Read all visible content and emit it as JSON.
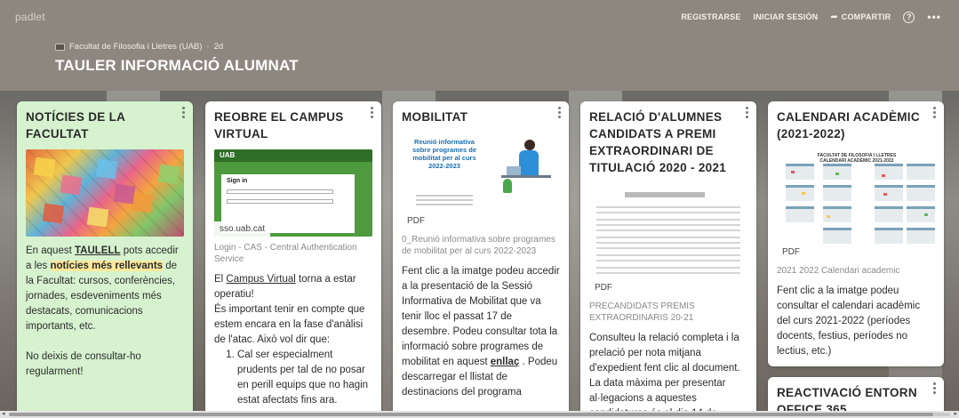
{
  "header": {
    "brand": "padlet",
    "nav": {
      "signup": "REGISTRARSE",
      "login": "INICIAR SESIÓN",
      "share": "COMPARTIR",
      "help_glyph": "?",
      "more_glyph": "•••",
      "share_glyph": "➦"
    },
    "author": "Facultat de Filosofia i Lletres (UAB)",
    "separator": "·",
    "age": "2d",
    "title": "TAULER INFORMACIÓ ALUMNAT"
  },
  "posts": [
    {
      "title": "NOTÍCIES DE LA FACULTAT",
      "body_pre": "En aquest ",
      "body_link": "TAULELL",
      "body_mid": " pots accedir a les ",
      "body_highlight": "notícies més rellevants",
      "body_post": " de la Facultat: cursos, conferències, jornades, esdeveniments més destacats, comunicacions importants, etc.",
      "body_2": "No deixis de consultar-ho regularment!"
    },
    {
      "title": "REOBRE EL CAMPUS VIRTUAL",
      "badge": "sso.uab.cat",
      "attachment_title": "Login - CAS - Central Authentication Service",
      "thumb_logo": "UAB",
      "thumb_heading": "Sign in",
      "body_pre": "El ",
      "body_link": "Campus Virtual",
      "body_post": " torna a estar operatiu!",
      "body_2": "És important tenir en compte que estem encara en la fase d'anàlisi de l'atac. Això vol dir que:",
      "list": [
        "Cal ser especialment prudents per tal de no posar en perill equips que no hagin estat afectats fins ara."
      ]
    },
    {
      "title": "MOBILITAT",
      "badge": "PDF",
      "thumb_title": "Reunió informativa sobre programes de mobilitat per al curs 2022-2023",
      "attachment_title": "0_Reunió informativa sobre programes de mobilitat per al curs 2022-2023",
      "body_pre": "Fent clic a la imatge podeu accedir a la presentació de la Sessió Informativa de Mobilitat que va tenir lloc el passat 17 de desembre. Podeu consultar tota la informació sobre programes de mobilitat en aquest ",
      "body_link": "enllaç",
      "body_post": " . Podeu descarregar el llistat de destinacions del programa"
    },
    {
      "title": "RELACIÓ D'ALUMNES CANDIDATS A PREMI EXTRAORDINARI DE TITULACIÓ 2020 - 2021",
      "badge": "PDF",
      "attachment_title": "PRECANDIDATS PREMIS EXTRAORDINARIS 20-21",
      "body": "Consulteu la relació completa i la prelació per nota mitjana d'expedient fent clic al document. La data màxima per presentar al·legacions a aquestes candidatures és el dia 14 de"
    },
    {
      "title": "CALENDARI ACADÈMIC (2021-2022)",
      "badge": "PDF",
      "thumb_title": "FACULTAT DE FILOSOFIA I LLETRES CALENDARI ACADÈMIC 2021-2022",
      "attachment_title": "2021 2022 Calendari academic",
      "body": "Fent clic a la imatge podeu consultar el calendari acadèmic del curs 2021-2022 (períodes docents, festius, períodes no lectius, etc.)"
    },
    {
      "title": "REACTIVACIÓ ENTORN OFFICE 365"
    }
  ],
  "colors": {
    "header_bg": "#8e8780",
    "note_green": "#d6f2cf",
    "highlight": "#fde89b",
    "uab_green": "#4f9a3f"
  },
  "icons": [
    "share-icon",
    "help-icon",
    "more-icon",
    "kebab-menu-icon"
  ]
}
